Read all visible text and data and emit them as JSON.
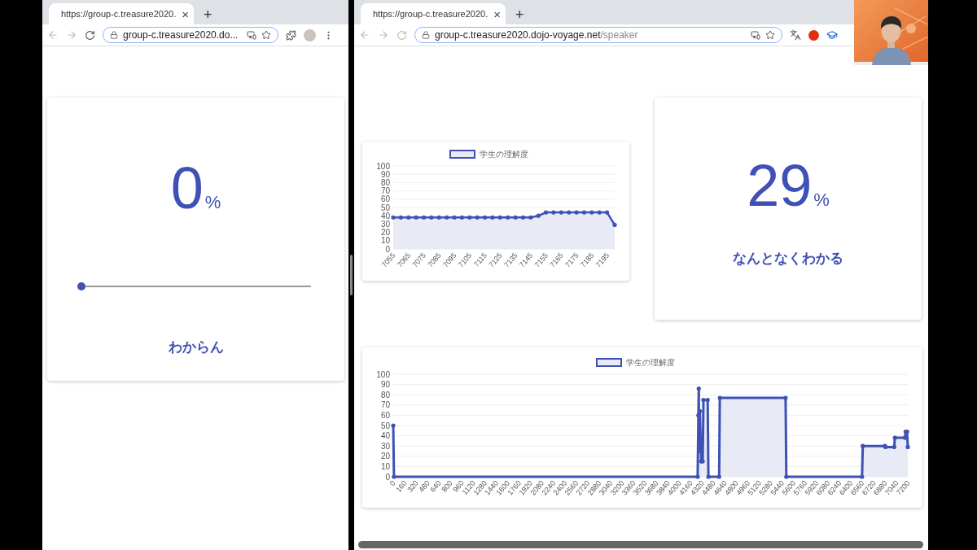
{
  "left_window": {
    "tab": {
      "title": "https://group-c.treasure2020.",
      "close": "×"
    },
    "new_tab": "+",
    "address": "group-c.treasure2020.do...",
    "student_card": {
      "value": "0",
      "unit": "%",
      "slider": {
        "level": 0
      },
      "label": "わからん"
    }
  },
  "right_window": {
    "tab": {
      "title": "https://group-c.treasure2020.",
      "close": "×"
    },
    "new_tab": "+",
    "address": {
      "host": "group-c.treasure2020.dojo-voyage.net",
      "path": "/speaker"
    },
    "chart_small": {
      "chart_data": {
        "type": "area",
        "x": [
          7055,
          7060,
          7065,
          7070,
          7075,
          7080,
          7085,
          7090,
          7095,
          7100,
          7105,
          7110,
          7115,
          7120,
          7125,
          7130,
          7135,
          7140,
          7145,
          7150,
          7155,
          7160,
          7165,
          7170,
          7175,
          7180,
          7185,
          7190,
          7195,
          7200
        ],
        "series": [
          {
            "name": "学生の理解度",
            "color": "#3f51b5",
            "values": [
              38,
              38,
              38,
              38,
              38,
              38,
              38,
              38,
              38,
              38,
              38,
              38,
              38,
              38,
              38,
              38,
              38,
              38,
              38,
              40,
              44,
              44,
              44,
              44,
              44,
              44,
              44,
              44,
              44,
              29
            ]
          }
        ],
        "grid": true,
        "xlim": [
          7055,
          7200
        ],
        "ylim": [
          0,
          100
        ],
        "xticks": [
          7055,
          7065,
          7075,
          7085,
          7095,
          7105,
          7115,
          7125,
          7135,
          7145,
          7155,
          7165,
          7175,
          7185,
          7195
        ],
        "yticks": [
          0,
          10,
          20,
          30,
          40,
          50,
          60,
          70,
          80,
          90,
          100
        ]
      }
    },
    "percent_card": {
      "value": "29",
      "unit": "%",
      "label": "なんとなくわかる"
    },
    "chart_large": {
      "chart_data": {
        "type": "area",
        "x": [
          0,
          10,
          4260,
          4270,
          4275,
          4280,
          4290,
          4310,
          4330,
          4340,
          4400,
          4410,
          4560,
          4570,
          5490,
          5500,
          6560,
          6570,
          6880,
          6890,
          7010,
          7020,
          7160,
          7170,
          7190,
          7200
        ],
        "series": [
          {
            "name": "学生の理解度",
            "color": "#3f51b5",
            "values": [
              50,
              0,
              0,
              60,
              86,
              25,
              64,
              15,
              15,
              75,
              75,
              0,
              0,
              77,
              77,
              0,
              0,
              30,
              30,
              29,
              29,
              38,
              38,
              44,
              44,
              29
            ]
          }
        ],
        "grid": true,
        "xlim": [
          0,
          7200
        ],
        "ylim": [
          0,
          100
        ],
        "xticks": [
          0,
          160,
          320,
          480,
          640,
          800,
          960,
          1120,
          1280,
          1440,
          1600,
          1760,
          1920,
          2080,
          2240,
          2400,
          2560,
          2720,
          2880,
          3040,
          3200,
          3360,
          3520,
          3680,
          3840,
          4000,
          4160,
          4320,
          4480,
          4640,
          4800,
          4960,
          5120,
          5280,
          5440,
          5600,
          5760,
          5920,
          6080,
          6240,
          6400,
          6560,
          6720,
          6880,
          7040,
          7200
        ],
        "yticks": [
          0,
          10,
          20,
          30,
          40,
          50,
          60,
          70,
          80,
          90,
          100
        ]
      }
    }
  }
}
